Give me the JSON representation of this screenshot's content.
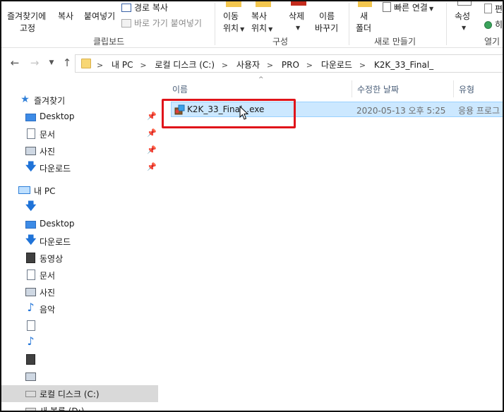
{
  "ribbon": {
    "clipboard": {
      "pin_label": "즐겨찾기에",
      "pin_label2": "고정",
      "copy": "복사",
      "paste": "붙여넣기",
      "copy_path": "경로 복사",
      "paste_shortcut": "바로 가기 붙여넣기",
      "group": "클립보드"
    },
    "organize": {
      "move_to": "이동",
      "move_to2": "위치",
      "copy_to": "복사",
      "copy_to2": "위치",
      "delete": "삭제",
      "rename": "이름",
      "rename2": "바꾸기",
      "group": "구성"
    },
    "new": {
      "new_folder": "새",
      "new_folder2": "폴더",
      "easy_access": "빠른 연결",
      "group": "새로 만들기"
    },
    "open": {
      "properties": "속성",
      "edit": "편",
      "history": "히",
      "group": "열기"
    }
  },
  "address": {
    "crumbs": [
      "내 PC",
      "로컬 디스크 (C:)",
      "사용자",
      "PRO",
      "다운로드",
      "K2K_33_Final_"
    ]
  },
  "columns": {
    "name": "이름",
    "modified": "수정한 날짜",
    "type": "유형"
  },
  "nav": {
    "quick_access": "즐겨찾기",
    "qa_items": [
      "Desktop",
      "문서",
      "사진",
      "다운로드"
    ],
    "this_pc": "내 PC",
    "pc_items": [
      "Desktop",
      "다운로드",
      "동영상",
      "문서",
      "사진",
      "음악"
    ],
    "local_disk": "로컬 디스크 (C:)",
    "new_volume": "새 볼륨 (D:)"
  },
  "files": [
    {
      "name": "K2K_33_Final_.exe",
      "modified": "2020-05-13 오후 5:25",
      "type": "응용 프로그"
    }
  ],
  "colors": {
    "selection_bg": "#cce8ff",
    "highlight_border": "#e0141a"
  }
}
